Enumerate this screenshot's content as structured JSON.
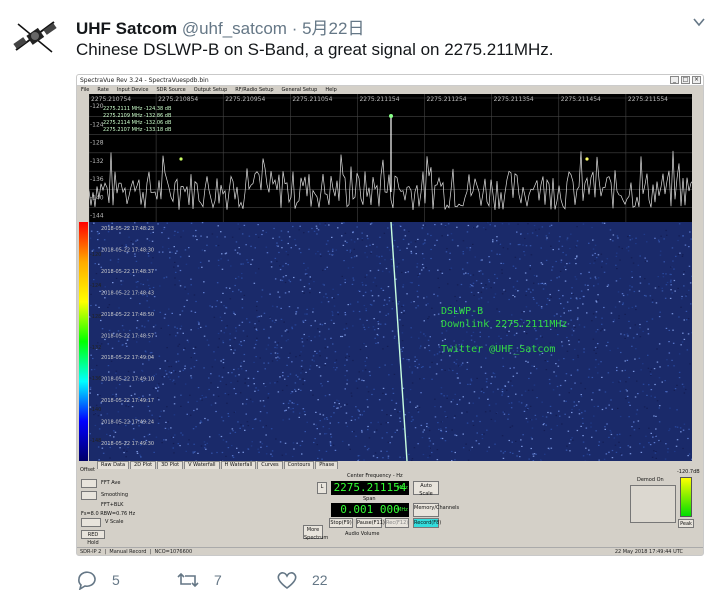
{
  "tweet": {
    "name": "UHF Satcom",
    "handle": "@uhf_satcom",
    "date": "5月22日",
    "text": "Chinese DSLWP-B on S-Band, a great signal on 2275.211MHz."
  },
  "actions": {
    "replies": "5",
    "retweets": "7",
    "likes": "22"
  },
  "app": {
    "window_title": "SpectraVue Rev 3.24 - SpectraVuespdb.bin",
    "menu": [
      "File",
      "Rate",
      "Input Device",
      "SDR Source",
      "Output Setup",
      "RF/Radio Setup",
      "General Setup",
      "Help"
    ],
    "freq_axis": [
      "2275.210754",
      "2275.210854",
      "2275.210954",
      "2275.211054",
      "2275.211154",
      "2275.211254",
      "2275.211354",
      "2275.211454",
      "2275.211554",
      "2275.2118"
    ],
    "spectrum_db_axis": [
      "-120",
      "-124",
      "-128",
      "-132",
      "-136",
      "-140",
      "-144"
    ],
    "waterfall_db_axis": [
      "-120",
      "-124",
      "-128",
      "-132",
      "-136",
      "-140",
      "-148"
    ],
    "waterfall_times": [
      "2018-05-22 17:48:23",
      "2018-05-22 17:48:30",
      "2018-05-22 17:48:37",
      "2018-05-22 17:48:43",
      "2018-05-22 17:48:50",
      "2018-05-22 17:48:57",
      "2018-05-22 17:49:04",
      "2018-05-22 17:49:10",
      "2018-05-22 17:49:17",
      "2018-05-22 17:49:24",
      "2018-05-22 17:49:30"
    ],
    "legend_lines": [
      "2275.2111 MHz -124.38 dB",
      "2275.2109 MHz -132.86 dB",
      "2275.2114 MHz -132.06 dB",
      "2275.2107 MHz -133.18 dB"
    ],
    "annotation": {
      "line1": "DSLWP-B",
      "line2": "Downlink 2275.2111MHz",
      "line3": "Twitter @UHF_Satcom"
    },
    "tabs": [
      "Raw Data",
      "2D Plot",
      "3D Plot",
      "V Waterfall",
      "H Waterfall",
      "Curves",
      "Contours",
      "Phase"
    ],
    "center_freq_label": "Center Frequency - Hz",
    "center_freq": "2275.211154",
    "center_unit": "MHz",
    "span_label": "Span",
    "span": "0.001 000",
    "span_unit": "MHz",
    "auto_scale": "Auto Scale",
    "memory": "Memory/Channels",
    "buttons": {
      "stop": "Stop(F9)",
      "pause": "Pause(F11)",
      "rec": "Rec(F12)",
      "record": "Record(F8)",
      "more": "More Spectrum",
      "audio": "Audio Volume"
    },
    "left_controls": {
      "offset": "Offset",
      "fft_ave": "FFT Ave",
      "smoothing": "Smoothing",
      "window": "FFT+BLK",
      "rbw": "Fs=8.0 RBW=0.76 Hz",
      "vscale": "V Scale",
      "reddot": "RED Hold"
    },
    "demod": "Demod On",
    "peak_label": "Peak",
    "scale_label": "-120.7dB",
    "status_left": "SDR-IP 2",
    "status_mid": "Manual Record",
    "status_nco": "NCO=1076600",
    "status_right": "22 May 2018  17:49:44 UTC"
  },
  "colors": {
    "name": "#14171a",
    "muted": "#657786",
    "lcd": "#33ff33",
    "annotation": "#33dd44",
    "waterfall": "#1a2a6a"
  },
  "icons": [
    "satellite-avatar",
    "chevron-down-icon",
    "reply-icon",
    "retweet-icon",
    "like-icon"
  ]
}
